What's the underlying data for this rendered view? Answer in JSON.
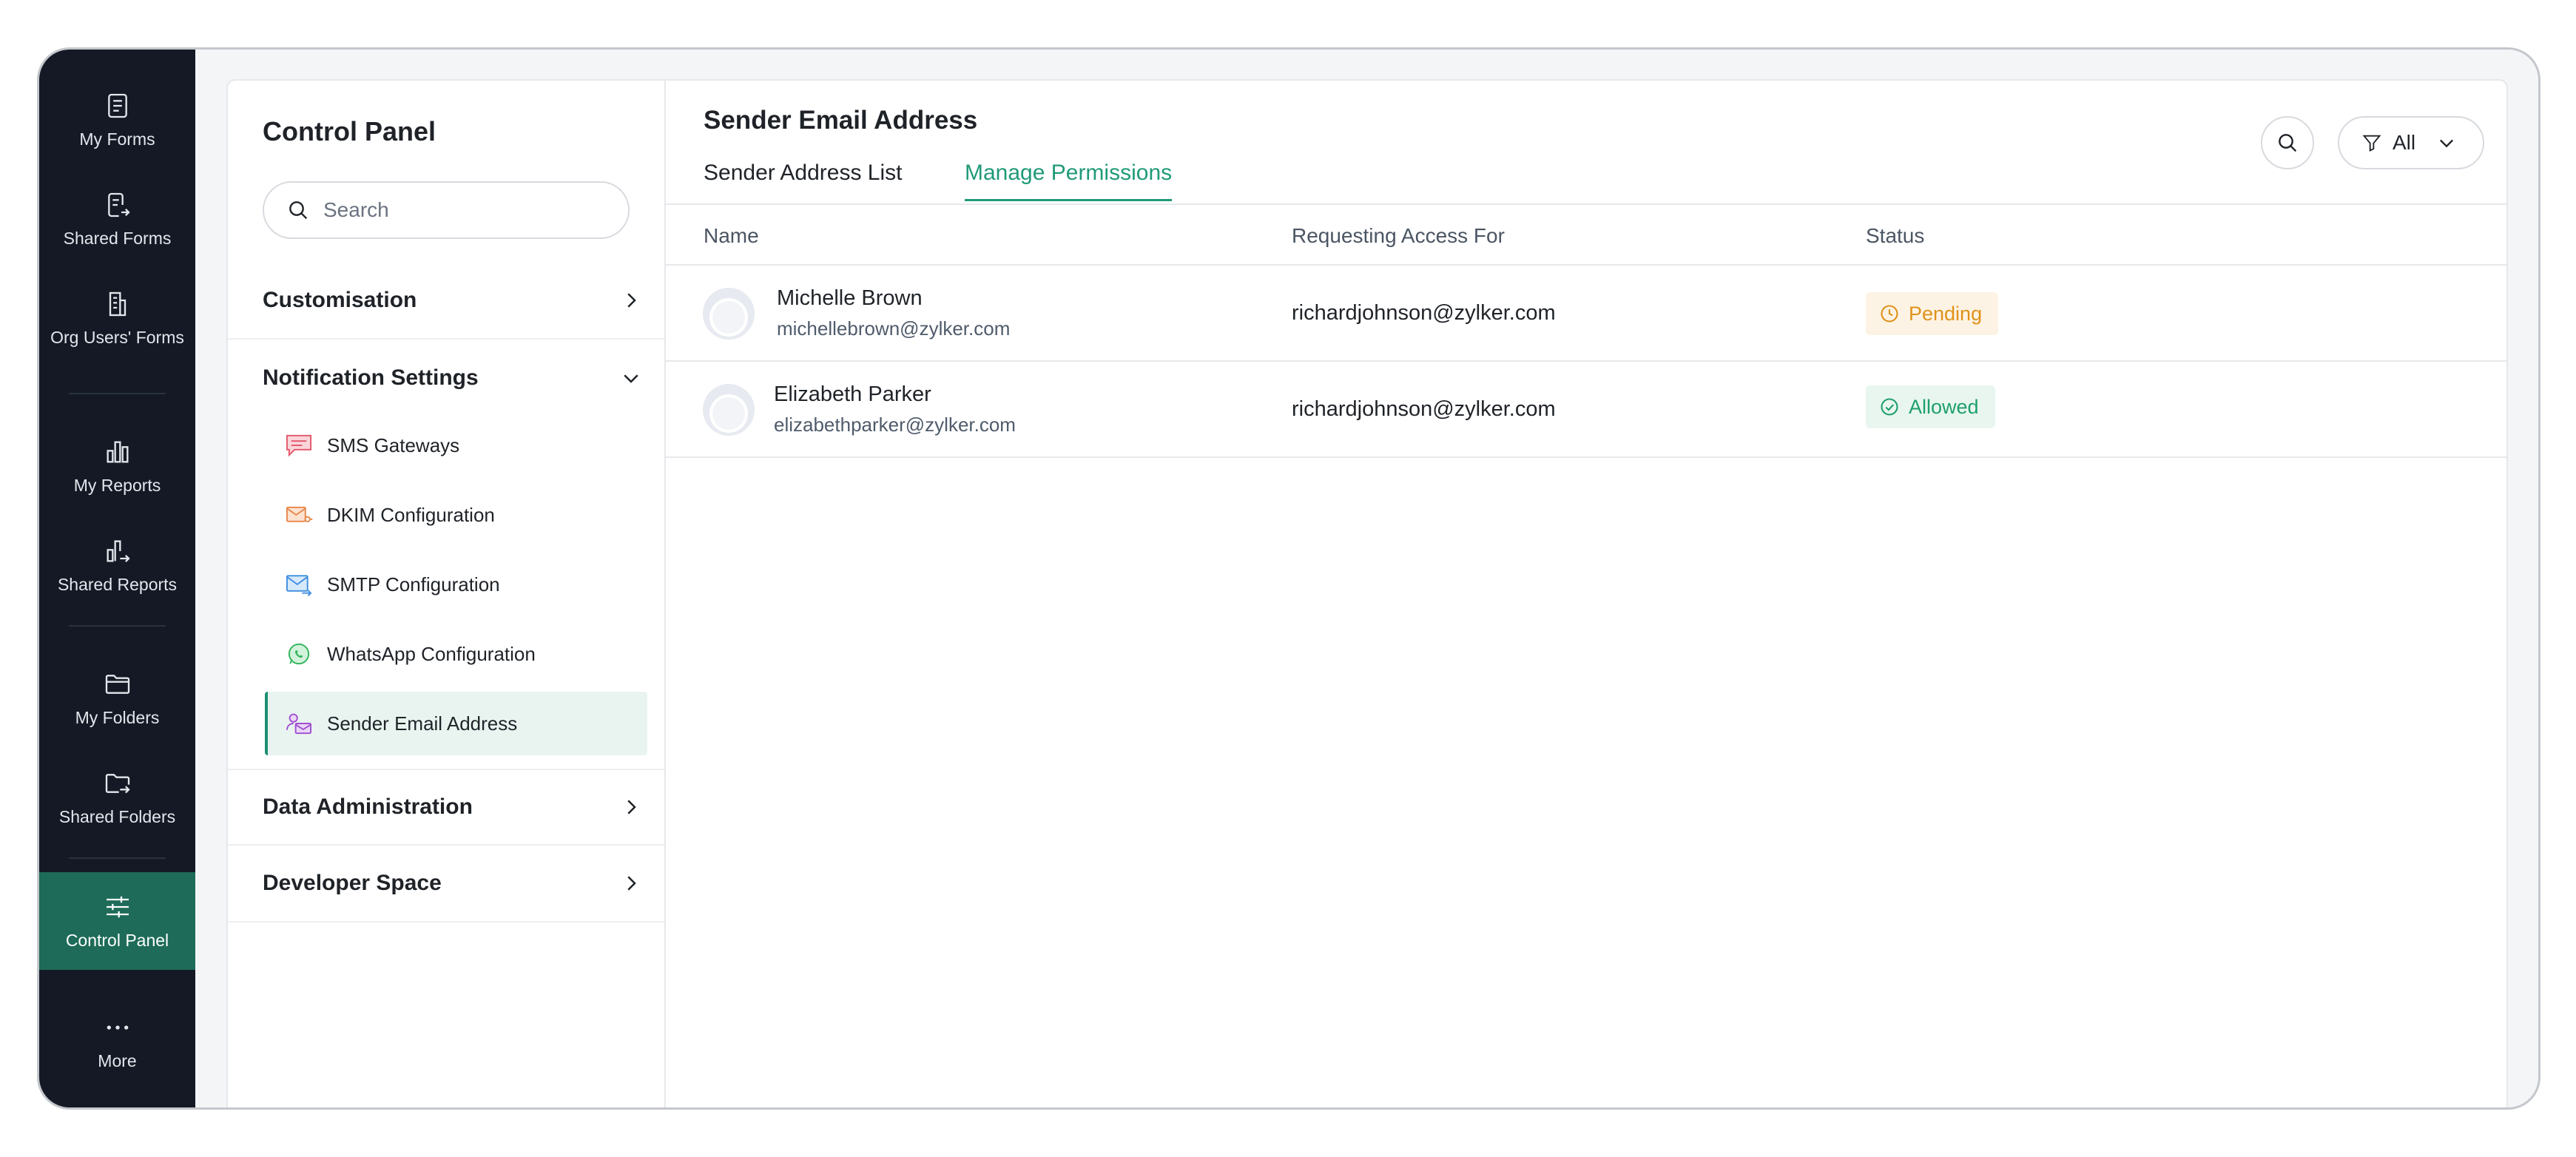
{
  "nav": {
    "items": [
      {
        "label": "My Forms",
        "icon": "document-icon"
      },
      {
        "label": "Shared Forms",
        "icon": "shared-document-icon"
      },
      {
        "label": "Org Users' Forms",
        "icon": "building-icon"
      },
      {
        "label": "My Reports",
        "icon": "bar-chart-icon"
      },
      {
        "label": "Shared Reports",
        "icon": "shared-chart-icon"
      },
      {
        "label": "My Folders",
        "icon": "folder-icon"
      },
      {
        "label": "Shared Folders",
        "icon": "shared-folder-icon"
      },
      {
        "label": "Control Panel",
        "icon": "sliders-icon"
      },
      {
        "label": "More",
        "icon": "more-dots-icon"
      }
    ]
  },
  "sidebar": {
    "title": "Control Panel",
    "search_placeholder": "Search",
    "sections": {
      "customisation": "Customisation",
      "notification_settings": "Notification Settings",
      "data_administration": "Data Administration",
      "developer_space": "Developer Space"
    },
    "children": [
      {
        "label": "SMS Gateways",
        "icon": "sms-chat-icon"
      },
      {
        "label": "DKIM Configuration",
        "icon": "dkim-mail-icon"
      },
      {
        "label": "SMTP Configuration",
        "icon": "smtp-mail-icon"
      },
      {
        "label": "WhatsApp Configuration",
        "icon": "whatsapp-icon"
      },
      {
        "label": "Sender Email Address",
        "icon": "sender-user-mail-icon"
      }
    ]
  },
  "main": {
    "title": "Sender Email Address",
    "tabs": [
      {
        "label": "Sender Address List"
      },
      {
        "label": "Manage Permissions"
      }
    ],
    "filter_value": "All",
    "columns": {
      "name": "Name",
      "requesting": "Requesting Access For",
      "status": "Status"
    },
    "rows": [
      {
        "name": "Michelle Brown",
        "email": "michellebrown@zylker.com",
        "requesting": "richardjohnson@zylker.com",
        "status": "Pending"
      },
      {
        "name": "Elizabeth Parker",
        "email": "elizabethparker@zylker.com",
        "requesting": "richardjohnson@zylker.com",
        "status": "Allowed"
      }
    ]
  },
  "colors": {
    "accent": "#1f9a78",
    "rail_bg": "#141925",
    "rail_active": "#1d6b58",
    "pending_text": "#e0921a",
    "pending_bg": "#fdf3e4",
    "allowed_text": "#1e9f6c",
    "allowed_bg": "#e8f6ef"
  }
}
